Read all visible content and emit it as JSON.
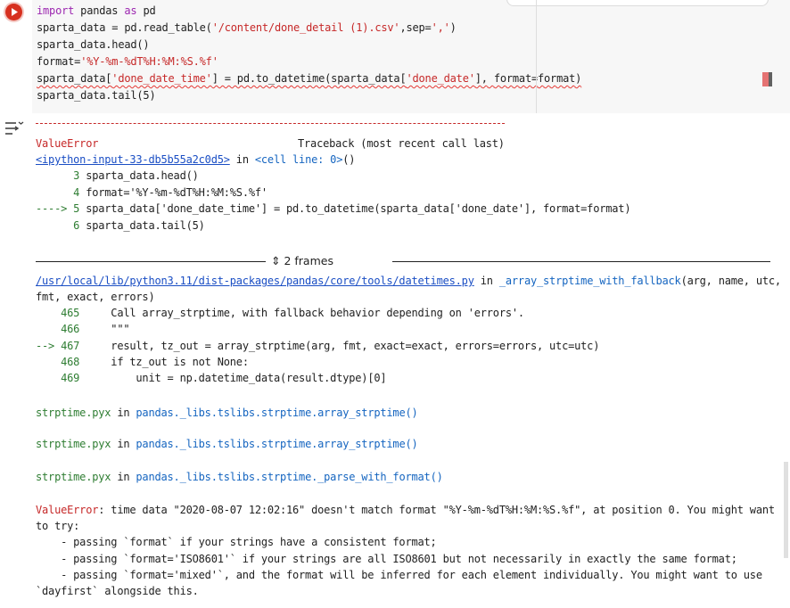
{
  "code_cell": {
    "lines": [
      [
        {
          "t": "import",
          "c": "kw"
        },
        {
          "t": " pandas "
        },
        {
          "t": "as",
          "c": "kw"
        },
        {
          "t": " pd"
        }
      ],
      [
        {
          "t": "sparta_data = pd.read_table("
        },
        {
          "t": "'/content/done_detail (1).csv'",
          "c": "str"
        },
        {
          "t": ",sep="
        },
        {
          "t": "','",
          "c": "str"
        },
        {
          "t": ")"
        }
      ],
      [
        {
          "t": "sparta_data.head()"
        }
      ],
      [
        {
          "t": "format="
        },
        {
          "t": "'%Y-%m-%dT%H:%M:%S.%f'",
          "c": "str"
        }
      ],
      [
        {
          "t": "sparta_data[",
          "c": "squig"
        },
        {
          "t": "'done_date_time'",
          "c": "str squig"
        },
        {
          "t": "] = pd.to_datetime(sparta_data[",
          "c": "squig"
        },
        {
          "t": "'done_date'",
          "c": "str squig"
        },
        {
          "t": "], format=format)",
          "c": "squig"
        }
      ],
      [
        {
          "t": "sparta_data.tail(5)"
        }
      ]
    ]
  },
  "output": {
    "dashes": "---------------------------------------------------------------------------",
    "error_name": "ValueError",
    "traceback_header": "Traceback (most recent call last)",
    "input_link": "<ipython-input-33-db5b55a2c0d5>",
    "in_text": " in ",
    "cell_line": "<cell line: 0>",
    "call_parens": "()",
    "tb1": [
      {
        "prefix": "      ",
        "num": "3",
        "code": " sparta_data.head()"
      },
      {
        "prefix": "      ",
        "num": "4",
        "code": " format='%Y-%m-%dT%H:%M:%S.%f'"
      },
      {
        "prefix": "----> ",
        "num": "5",
        "code": " sparta_data['done_date_time'] = pd.to_datetime(sparta_data['done_date'], format=format)"
      },
      {
        "prefix": "      ",
        "num": "6",
        "code": " sparta_data.tail(5)"
      }
    ],
    "frames_label": "2 frames",
    "file_link": "/usr/local/lib/python3.11/dist-packages/pandas/core/tools/datetimes.py",
    "func_name": "_array_strptime_with_fallback",
    "func_args_a": "(arg, name, utc,",
    "func_args_b": "fmt, exact, errors)",
    "tb2": [
      {
        "prefix": "    ",
        "num": "465",
        "code": "     Call array_strptime, with fallback behavior depending on 'errors'."
      },
      {
        "prefix": "    ",
        "num": "466",
        "code": "     \"\"\""
      },
      {
        "prefix": "--> ",
        "num": "467",
        "code": "     result, tz_out = array_strptime(arg, fmt, exact=exact, errors=errors, utc=utc)"
      },
      {
        "prefix": "    ",
        "num": "468",
        "code": "     if tz_out is not None:"
      },
      {
        "prefix": "    ",
        "num": "469",
        "code": "         unit = np.datetime_data(result.dtype)[0]"
      }
    ],
    "pyx": [
      {
        "file": "strptime.pyx",
        "in": " in ",
        "func": "pandas._libs.tslibs.strptime.array_strptime()"
      },
      {
        "file": "strptime.pyx",
        "in": " in ",
        "func": "pandas._libs.tslibs.strptime.array_strptime()"
      },
      {
        "file": "strptime.pyx",
        "in": " in ",
        "func": "pandas._libs.tslibs.strptime._parse_with_format()"
      }
    ],
    "final_error_name": "ValueError",
    "final_message": [
      ": time data \"2020-08-07 12:02:16\" doesn't match format \"%Y-%m-%dT%H:%M:%S.%f\", at position 0. You might want",
      "to try:",
      "    - passing `format` if your strings have a consistent format;",
      "    - passing `format='ISO8601'` if your strings are all ISO8601 but not necessarily in exactly the same format;",
      "    - passing `format='mixed'`, and the format will be inferred for each element individually. You might want to use",
      "`dayfirst` alongside this."
    ]
  },
  "colors": {
    "error": "#c62828",
    "link": "#1a4ec4",
    "keyword": "#9c27b0",
    "run_button": "#d7301f"
  },
  "icons": {
    "run": "play-circle-icon",
    "output_menu": "output-options-icon",
    "frames": "unfold-icon"
  }
}
